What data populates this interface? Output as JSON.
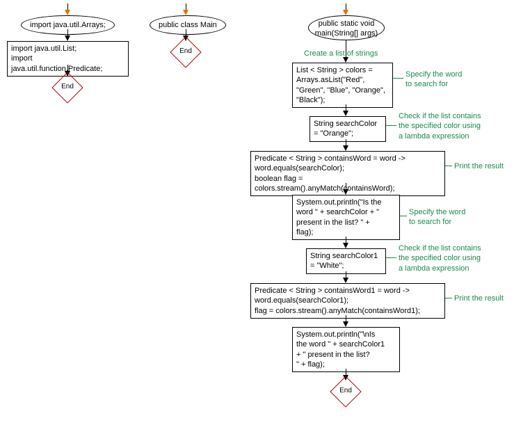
{
  "flowcharts": [
    {
      "id": "f1",
      "start": "import java.util.Arrays;",
      "nodes": [
        {
          "id": "n1",
          "text": "import java.util.List;\nimport java.util.function.Predicate;"
        }
      ],
      "end": "End"
    },
    {
      "id": "f2",
      "start": "public class Main",
      "nodes": [],
      "end": "End"
    },
    {
      "id": "f3",
      "start": "public static void\nmain(String[] args)",
      "nodes": [
        {
          "id": "n3a",
          "text": "List < String > colors =\nArrays.asList(\"Red\",\n\"Green\", \"Blue\", \"Orange\",\n\"Black\");",
          "comment": "Create a list of strings"
        },
        {
          "id": "n3b",
          "text": "String searchColor\n= \"Orange\";",
          "comment": "Specify the word\nto search for"
        },
        {
          "id": "n3c",
          "text": "Predicate < String > containsWord = word ->\nword.equals(searchColor);\nboolean flag = colors.stream().anyMatch(containsWord);",
          "comment": "Check if the list contains\nthe specified color using\na lambda expression"
        },
        {
          "id": "n3d",
          "text": "System.out.println(\"Is the\nword \" + searchColor + \"\npresent in the list? \" +\nflag);",
          "comment": "Print the result"
        },
        {
          "id": "n3e",
          "text": "String searchColor1\n= \"White\";",
          "comment": "Specify the word\nto search for"
        },
        {
          "id": "n3f",
          "text": "Predicate < String > containsWord1 = word ->\nword.equals(searchColor1);\nflag = colors.stream().anyMatch(containsWord1);",
          "comment": "Check if the list contains\nthe specified color using\na lambda expression"
        },
        {
          "id": "n3g",
          "text": "System.out.println(\"\\nIs\nthe word \" + searchColor1\n+ \" present in the list?\n\" + flag);",
          "comment": "Print the result"
        }
      ],
      "end": "End"
    }
  ]
}
